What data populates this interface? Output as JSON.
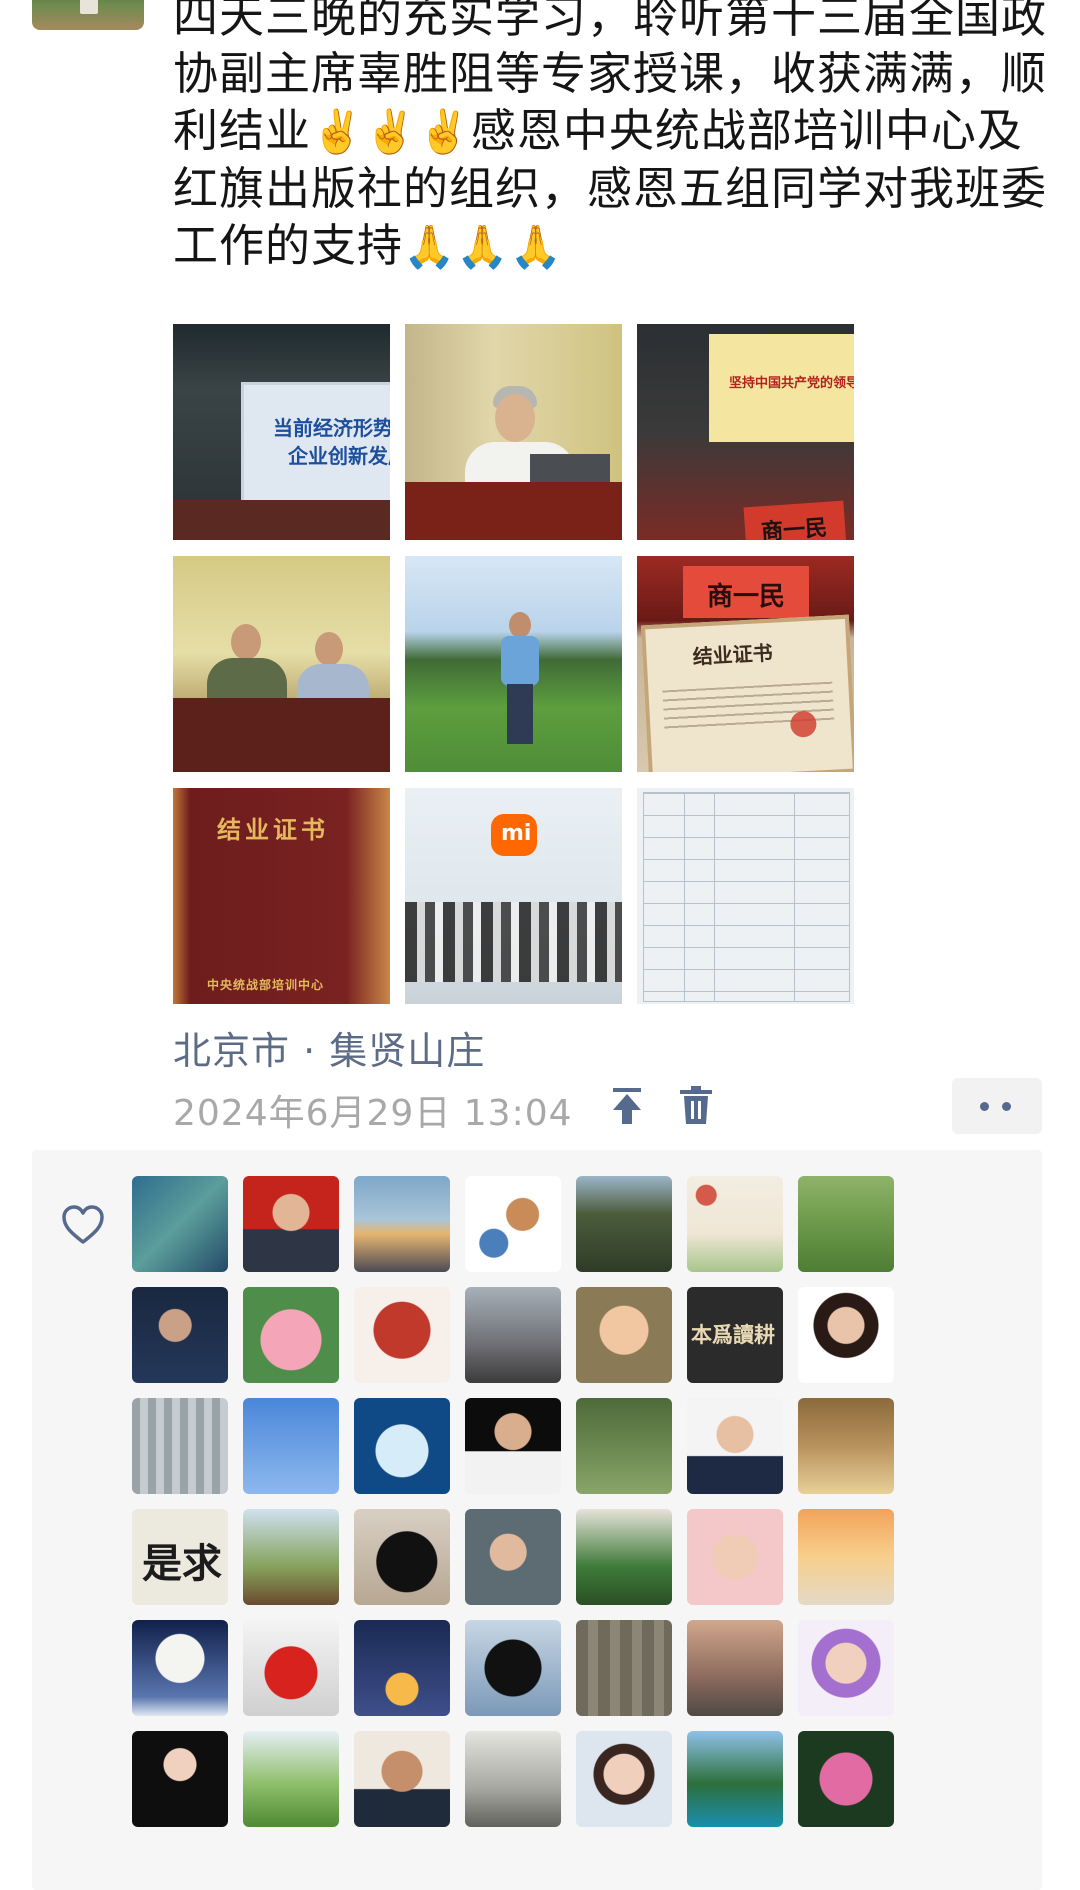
{
  "post": {
    "text_parts": [
      "四天三晚的充实学习，聆听第十三届全国政协副主席辜胜阻等专家授课，收获满满，顺利结业",
      "感恩中央统战部培训中心及红旗出版社的组织，感恩五组同学对我班委工作的支持"
    ],
    "emoji_victory": "✌️✌️✌️",
    "emoji_pray": "🙏🙏🙏",
    "photos": [
      {
        "icon": "slide-photo",
        "caption": "当前经济形势",
        "caption2": "企业创新发展"
      },
      {
        "icon": "lecturer-photo"
      },
      {
        "icon": "screen-photo",
        "caption": "坚持中国共产党的领导",
        "plate": "商一民"
      },
      {
        "icon": "panel-photo"
      },
      {
        "icon": "lawn-photo"
      },
      {
        "icon": "certificate-photo",
        "plate": "商一民",
        "caption": "结业证书"
      },
      {
        "icon": "certificate-cover-photo",
        "caption": "结业证书",
        "caption2": "中央统战部培训中心"
      },
      {
        "icon": "group-photo",
        "logo": "mi"
      },
      {
        "icon": "schedule-photo"
      }
    ],
    "location": "北京市 · 集贤山庄",
    "timestamp": "2024年6月29日 13:04"
  },
  "colors": {
    "link": "#5c6b86",
    "meta": "#a8a8a8",
    "icon_blue": "#566a8d",
    "panel_bg": "#f6f6f6"
  },
  "likes": {
    "icon": "heart-outline-icon",
    "avatar_captions": {
      "calligraphy_1": "本爲讀耕",
      "calligraphy_2": "是求"
    }
  }
}
